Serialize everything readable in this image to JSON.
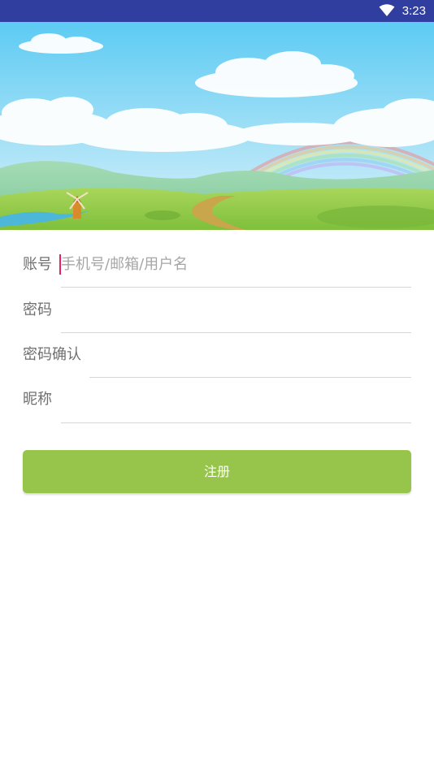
{
  "status_bar": {
    "time": "3:23",
    "wifi_icon": "wifi-icon"
  },
  "banner": {
    "image": "landscape-rainbow-windmill-illustration"
  },
  "form": {
    "account": {
      "label": "账号",
      "placeholder": "手机号/邮箱/用户名",
      "value": ""
    },
    "password": {
      "label": "密码",
      "value": ""
    },
    "password_confirm": {
      "label": "密码确认",
      "value": ""
    },
    "nickname": {
      "label": "昵称",
      "value": ""
    }
  },
  "register_button": {
    "label": "注册"
  },
  "colors": {
    "status_bar": "#303f9f",
    "button": "#97c54b",
    "caret": "#e91e63"
  }
}
